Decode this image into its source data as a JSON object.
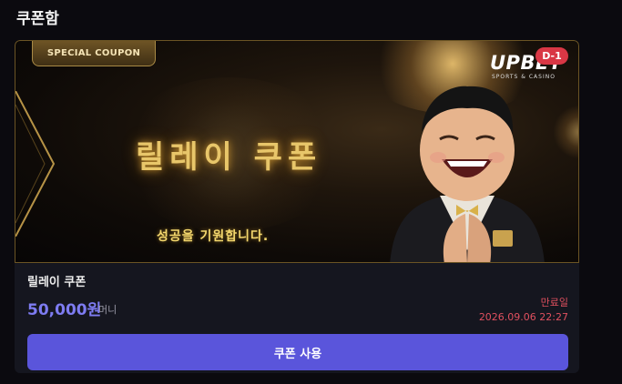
{
  "page": {
    "title": "쿠폰함"
  },
  "coupon": {
    "badge": "SPECIAL COUPON",
    "banner_title": "릴레이 쿠폰",
    "banner_tagline": "성공을 기원합니다.",
    "brand": {
      "logo_text": "UPBET",
      "logo_sub": "SPORTS & CASINO"
    },
    "dday": "D-1",
    "name": "릴레이 쿠폰",
    "amount": "50,000원",
    "currency": "머니",
    "expiry_label": "만료일",
    "expiry_date": "2026.09.06 22:27",
    "use_button_label": "쿠폰 사용"
  },
  "colors": {
    "background": "#0b0a0f",
    "card": "#15161f",
    "accent": "#5a55db",
    "amount": "#7e7cf2",
    "expiry": "#e0505f",
    "gold": "#e8c66a"
  }
}
